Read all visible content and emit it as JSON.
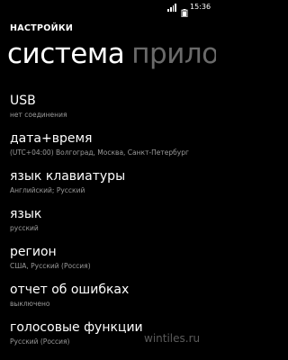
{
  "status_bar": {
    "time": "15:36",
    "icons": [
      "signal-icon",
      "battery-icon"
    ]
  },
  "header": {
    "app_title": "НАСТРОЙКИ",
    "pivot": {
      "active": "система",
      "next": "прило"
    }
  },
  "settings": {
    "items": [
      {
        "title": "USB",
        "subtitle": "нет соединения"
      },
      {
        "title": "дата+время",
        "subtitle": "(UTC+04:00) Волгоград, Москва, Санкт-Петербург"
      },
      {
        "title": "язык клавиатуры",
        "subtitle": "Английский; Русский"
      },
      {
        "title": "язык",
        "subtitle": "русский"
      },
      {
        "title": "регион",
        "subtitle": "США, Русский (Россия)"
      },
      {
        "title": "отчет об ошибках",
        "subtitle": "выключено"
      },
      {
        "title": "голосовые функции",
        "subtitle": "Русский (Россия)"
      }
    ]
  },
  "watermark": "wintiles.ru",
  "colors": {
    "background": "#000000",
    "text": "#ffffff",
    "secondary_text": "#9a9a9a",
    "inactive_pivot": "#6a6a6a"
  }
}
